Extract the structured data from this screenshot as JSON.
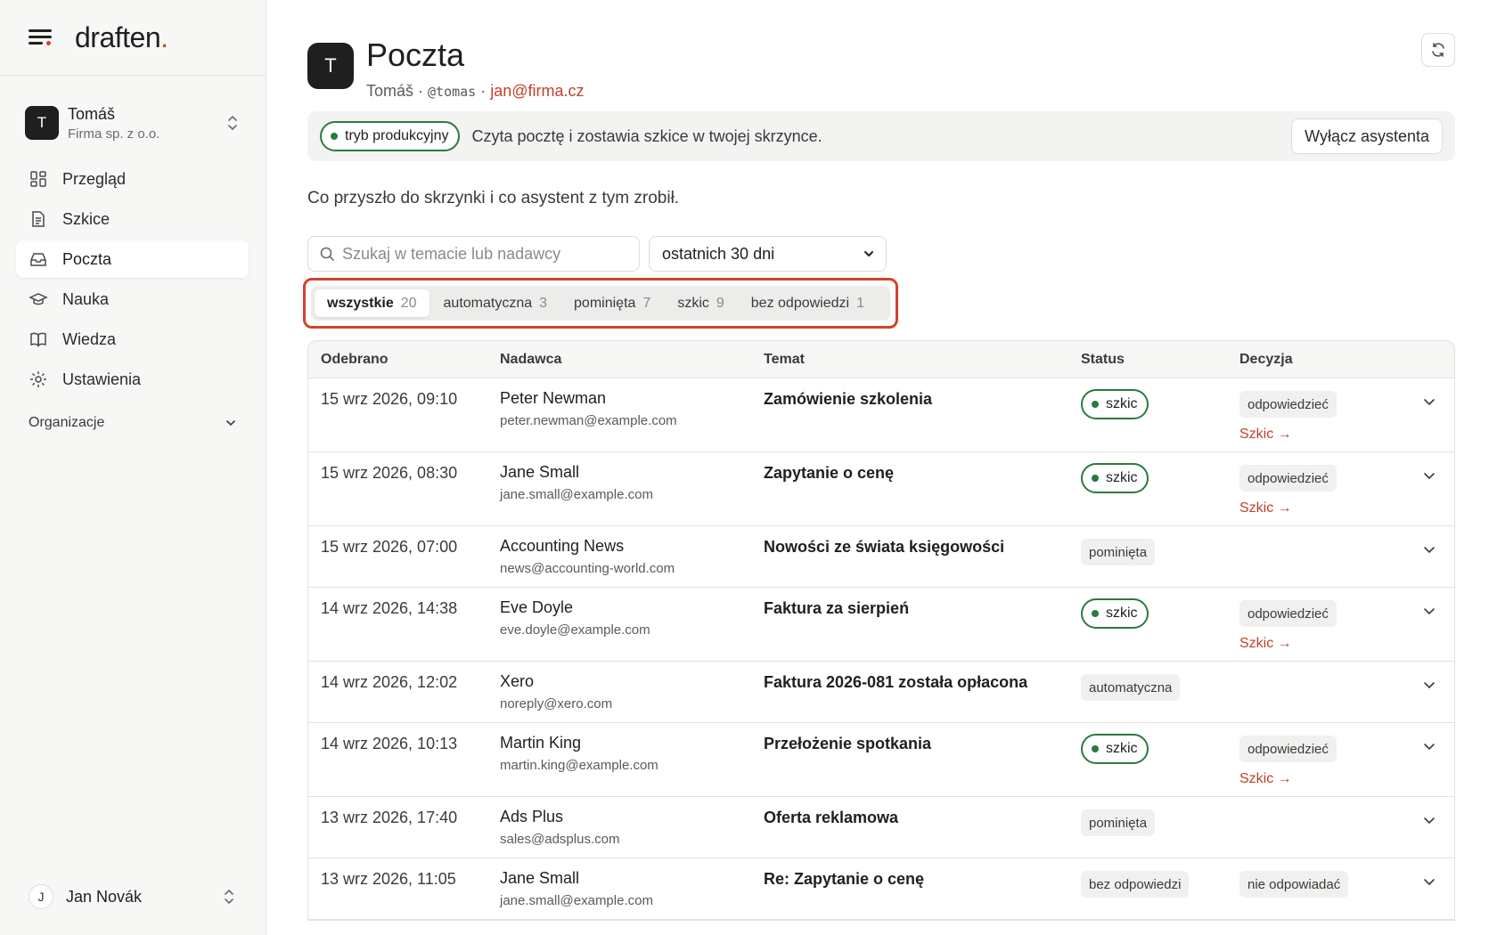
{
  "app": {
    "logo_text": "draften",
    "logo_dot": "."
  },
  "account": {
    "initial": "T",
    "name": "Tomáš",
    "org": "Firma sp. z o.o."
  },
  "nav": [
    {
      "label": "Przegląd",
      "icon": "dashboard-icon"
    },
    {
      "label": "Szkice",
      "icon": "document-icon"
    },
    {
      "label": "Poczta",
      "icon": "inbox-icon",
      "active": true
    },
    {
      "label": "Nauka",
      "icon": "graduation-cap-icon"
    },
    {
      "label": "Wiedza",
      "icon": "book-icon"
    },
    {
      "label": "Ustawienia",
      "icon": "gear-icon"
    }
  ],
  "org_section": {
    "label": "Organizacje"
  },
  "user": {
    "initial": "J",
    "name": "Jan Novák"
  },
  "header": {
    "initial": "T",
    "title": "Poczta",
    "name": "Tomáš",
    "sep1": " · ",
    "handle": "@tomas",
    "sep2": " · ",
    "email": "jan@firma.cz"
  },
  "banner": {
    "mode": "tryb produkcyjny",
    "text": "Czyta pocztę i zostawia szkice w twojej skrzynce.",
    "button": "Wyłącz asystenta"
  },
  "intro": "Co przyszło do skrzynki i co asystent z tym zrobił.",
  "filters": {
    "search_placeholder": "Szukaj w temacie lub nadawcy",
    "range": "ostatnich 30 dni"
  },
  "tabs": [
    {
      "label": "wszystkie",
      "count": "20",
      "active": true
    },
    {
      "label": "automatyczna",
      "count": "3"
    },
    {
      "label": "pominięta",
      "count": "7"
    },
    {
      "label": "szkic",
      "count": "9"
    },
    {
      "label": "bez odpowiedzi",
      "count": "1"
    }
  ],
  "table": {
    "headers": {
      "date": "Odebrano",
      "sender": "Nadawca",
      "subject": "Temat",
      "status": "Status",
      "decision": "Decyzja"
    },
    "rows": [
      {
        "date": "15 wrz 2026, 09:10",
        "sender": "Peter Newman",
        "email": "peter.newman@example.com",
        "subject": "Zamówienie szkolenia",
        "status": "szkic",
        "decision": "odpowiedzieć",
        "link": "Szkic →"
      },
      {
        "date": "15 wrz 2026, 08:30",
        "sender": "Jane Small",
        "email": "jane.small@example.com",
        "subject": "Zapytanie o cenę",
        "status": "szkic",
        "decision": "odpowiedzieć",
        "link": "Szkic →"
      },
      {
        "date": "15 wrz 2026, 07:00",
        "sender": "Accounting News",
        "email": "news@accounting-world.com",
        "subject": "Nowości ze świata księgowości",
        "status": "pominięta",
        "decision": "",
        "link": ""
      },
      {
        "date": "14 wrz 2026, 14:38",
        "sender": "Eve Doyle",
        "email": "eve.doyle@example.com",
        "subject": "Faktura za sierpień",
        "status": "szkic",
        "decision": "odpowiedzieć",
        "link": "Szkic →"
      },
      {
        "date": "14 wrz 2026, 12:02",
        "sender": "Xero",
        "email": "noreply@xero.com",
        "subject": "Faktura 2026-081 została opłacona",
        "status": "automatyczna",
        "decision": "",
        "link": ""
      },
      {
        "date": "14 wrz 2026, 10:13",
        "sender": "Martin King",
        "email": "martin.king@example.com",
        "subject": "Przełożenie spotkania",
        "status": "szkic",
        "decision": "odpowiedzieć",
        "link": "Szkic →"
      },
      {
        "date": "13 wrz 2026, 17:40",
        "sender": "Ads Plus",
        "email": "sales@adsplus.com",
        "subject": "Oferta reklamowa",
        "status": "pominięta",
        "decision": "",
        "link": ""
      },
      {
        "date": "13 wrz 2026, 11:05",
        "sender": "Jane Small",
        "email": "jane.small@example.com",
        "subject": "Re: Zapytanie o cenę",
        "status": "bez odpowiedzi",
        "decision": "nie odpowiadać",
        "link": ""
      }
    ]
  },
  "colors": {
    "accent": "#d2432a",
    "link": "#c2412a",
    "success": "#2b7a3d"
  }
}
